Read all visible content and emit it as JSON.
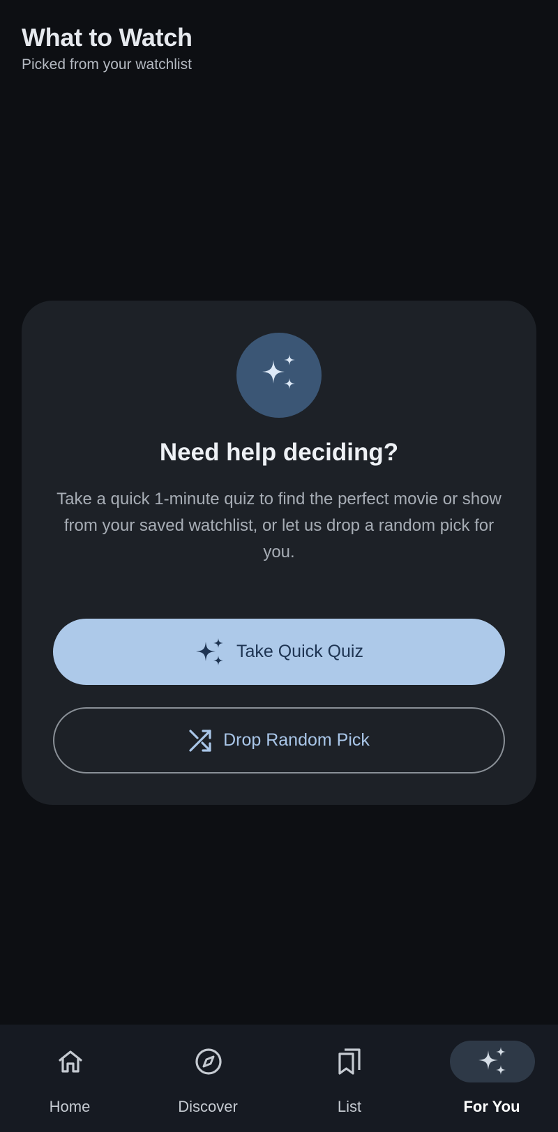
{
  "header": {
    "title": "What to Watch",
    "subtitle": "Picked from your watchlist"
  },
  "card": {
    "icon": "sparkles-icon",
    "title": "Need help deciding?",
    "description": "Take a quick 1-minute quiz to find the perfect movie or show from your saved watchlist, or let us drop a random pick for you.",
    "primary_button": {
      "label": "Take Quick Quiz",
      "icon": "sparkles-icon"
    },
    "secondary_button": {
      "label": "Drop Random Pick",
      "icon": "shuffle-icon"
    }
  },
  "bottom_nav": {
    "items": [
      {
        "label": "Home",
        "icon": "home-icon",
        "active": false
      },
      {
        "label": "Discover",
        "icon": "compass-icon",
        "active": false
      },
      {
        "label": "List",
        "icon": "bookmarks-icon",
        "active": false
      },
      {
        "label": "For You",
        "icon": "sparkles-icon",
        "active": true
      }
    ]
  },
  "colors": {
    "background": "#0d0f13",
    "card": "#1d2127",
    "accent": "#adc9e9",
    "hero_circle": "#3b5675",
    "nav_background": "#161a22"
  }
}
